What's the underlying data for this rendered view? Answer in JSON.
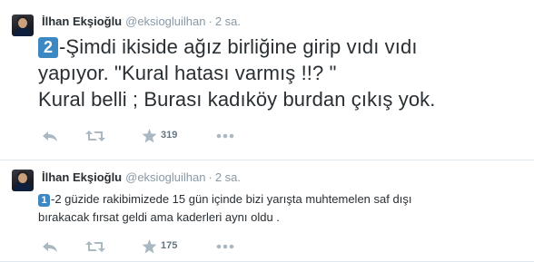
{
  "tweets": [
    {
      "author_name": "İlhan Ekşioğlu",
      "handle": "@eksiogluilhan",
      "separator": "·",
      "time": "2 sa.",
      "number_badge": "2",
      "text_line1": "-Şimdi ikiside ağız birliğine girip vıdı vıdı",
      "text_line2": "yapıyor. \"Kural hatası varmış !!? \"",
      "text_line3": "Kural belli ; Burası kadıköy burdan çıkış yok.",
      "favorite_count": "319"
    },
    {
      "author_name": "İlhan Ekşioğlu",
      "handle": "@eksiogluilhan",
      "separator": "·",
      "time": "2 sa.",
      "number_badge": "1",
      "text_line1": "-2 güzide rakibimizede 15 gün içinde bizi yarışta muhtemelen saf dışı",
      "text_line2": "bırakacak fırsat geldi ama kaderleri aynı oldu .",
      "favorite_count": "175"
    }
  ],
  "icons": {
    "reply": "reply-icon",
    "retweet": "retweet-icon",
    "favorite": "star-icon",
    "more": "more-icon"
  },
  "colors": {
    "text": "#292f33",
    "muted": "#8899a6",
    "action_icon": "#aab8c2",
    "keycap": "#3b88c3",
    "divider": "#e1e8ed"
  }
}
